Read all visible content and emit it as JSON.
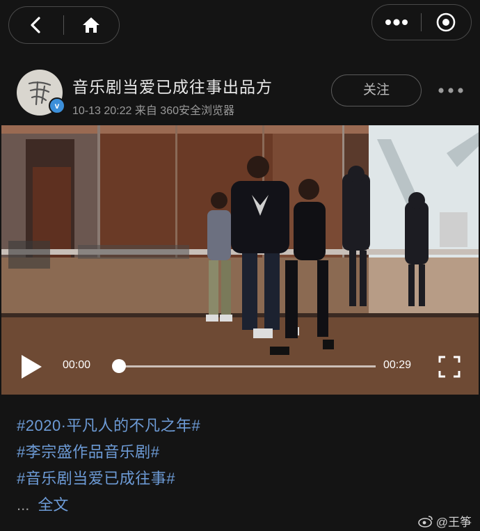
{
  "nav": {
    "back_icon": "chevron-left-icon",
    "home_icon": "home-icon",
    "more_icon": "ellipsis-icon",
    "target_icon": "target-icon"
  },
  "post": {
    "account_name": "音乐剧当爱已成往事出品方",
    "avatar_text": "爱已成往事",
    "meta": "10-13 20:22 来自 360安全浏览器",
    "follow_label": "关注",
    "verified_mark": "v"
  },
  "video": {
    "current_time": "00:00",
    "total_time": "00:29",
    "progress": 0
  },
  "tags": [
    "#2020·平凡人的不凡之年#",
    "#李宗盛作品音乐剧#",
    "#音乐剧当爱已成往事#"
  ],
  "expand": {
    "dots": "...",
    "label": "全文"
  },
  "watermark": {
    "text": "@王筝"
  },
  "colors": {
    "background": "#141414",
    "link": "#6d9bd6",
    "verified": "#3c8fd9"
  }
}
